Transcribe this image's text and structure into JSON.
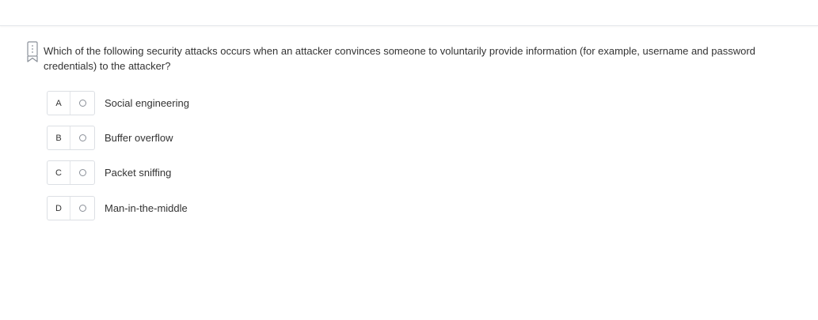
{
  "question": {
    "text": "Which of the following security attacks occurs when an attacker convinces someone to voluntarily provide information (for example, username and password credentials) to the attacker?",
    "bookmark_icon": "bookmark-icon"
  },
  "options": [
    {
      "letter": "A",
      "label": "Social engineering"
    },
    {
      "letter": "B",
      "label": "Buffer overflow"
    },
    {
      "letter": "C",
      "label": "Packet sniffing"
    },
    {
      "letter": "D",
      "label": "Man-in-the-middle"
    }
  ],
  "colors": {
    "border": "#dcdfe4",
    "text": "#333333",
    "bookmark": "#8a9099"
  }
}
